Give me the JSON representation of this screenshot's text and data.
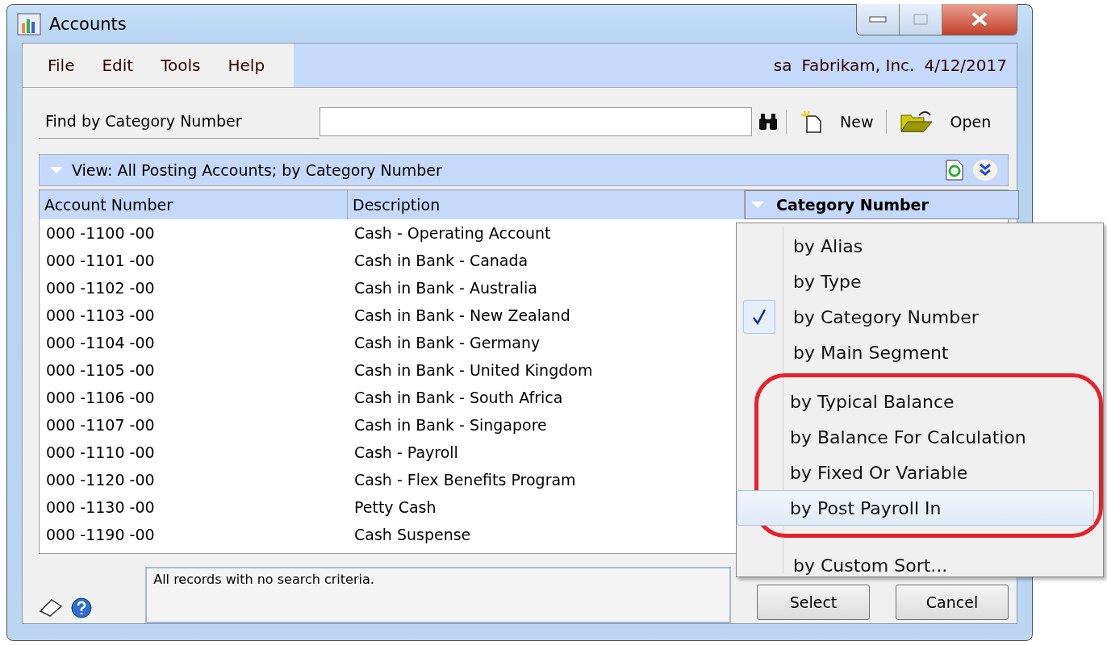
{
  "window": {
    "title": "Accounts"
  },
  "menu_bar": {
    "items": [
      "File",
      "Edit",
      "Tools",
      "Help"
    ],
    "user": "sa",
    "company": "Fabrikam, Inc.",
    "date": "4/12/2017"
  },
  "find": {
    "label": "Find by Category Number"
  },
  "toolbar": {
    "new": "New",
    "open": "Open"
  },
  "view": {
    "title": "View: All Posting Accounts; by Category Number"
  },
  "table": {
    "columns": [
      "Account Number",
      "Description",
      "Category Number"
    ],
    "rows": [
      {
        "account": "000 -1100 -00",
        "description": "Cash - Operating Account"
      },
      {
        "account": "000 -1101 -00",
        "description": "Cash in Bank - Canada"
      },
      {
        "account": "000 -1102 -00",
        "description": "Cash in Bank - Australia"
      },
      {
        "account": "000 -1103 -00",
        "description": "Cash in Bank - New Zealand"
      },
      {
        "account": "000 -1104 -00",
        "description": "Cash in Bank - Germany"
      },
      {
        "account": "000 -1105 -00",
        "description": "Cash in Bank - United Kingdom"
      },
      {
        "account": "000 -1106 -00",
        "description": "Cash in Bank - South Africa"
      },
      {
        "account": "000 -1107 -00",
        "description": "Cash in Bank - Singapore"
      },
      {
        "account": "000 -1110 -00",
        "description": "Cash - Payroll"
      },
      {
        "account": "000 -1120 -00",
        "description": "Cash - Flex Benefits Program"
      },
      {
        "account": "000 -1130 -00",
        "description": "Petty Cash"
      },
      {
        "account": "000 -1190 -00",
        "description": "Cash Suspense"
      }
    ]
  },
  "sort_menu": {
    "groups": [
      {
        "highlighted": false,
        "items": [
          {
            "label": "by Alias",
            "checked": false,
            "selected": false
          },
          {
            "label": "by Type",
            "checked": false,
            "selected": false
          },
          {
            "label": "by Category Number",
            "checked": true,
            "selected": false
          },
          {
            "label": "by Main Segment",
            "checked": false,
            "selected": false
          }
        ]
      },
      {
        "highlighted": true,
        "items": [
          {
            "label": "by Typical Balance",
            "checked": false,
            "selected": false
          },
          {
            "label": "by Balance For Calculation",
            "checked": false,
            "selected": false
          },
          {
            "label": "by Fixed Or Variable",
            "checked": false,
            "selected": false
          },
          {
            "label": "by Post Payroll In",
            "checked": false,
            "selected": true
          }
        ]
      },
      {
        "highlighted": false,
        "items": [
          {
            "label": "by Custom Sort...",
            "checked": false,
            "selected": false
          }
        ]
      }
    ]
  },
  "status": {
    "message": "All records with no search criteria."
  },
  "buttons": [
    "Select",
    "Cancel"
  ]
}
